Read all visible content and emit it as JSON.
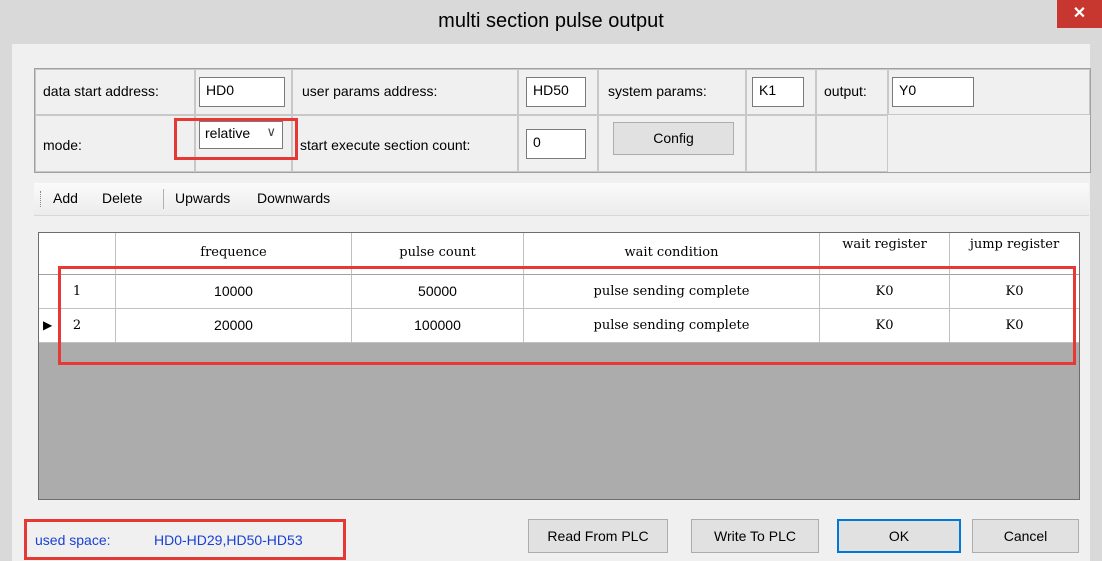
{
  "window": {
    "title": "multi section pulse output",
    "close_glyph": "✕"
  },
  "params": {
    "data_start_label": "data start address:",
    "data_start_value": "HD0",
    "user_params_label": "user params address:",
    "user_params_value": "HD50",
    "system_params_label": "system params:",
    "system_params_value": "K1",
    "output_label": "output:",
    "output_value": "Y0",
    "mode_label": "mode:",
    "mode_value": "relative",
    "start_exec_label": "start execute section count:",
    "start_exec_value": "0",
    "config_button": "Config"
  },
  "toolbar": {
    "add": "Add",
    "delete": "Delete",
    "upwards": "Upwards",
    "downwards": "Downwards"
  },
  "table": {
    "columns": [
      "frequence",
      "pulse count",
      "wait condition",
      "wait register",
      "jump register"
    ],
    "rows": [
      {
        "index": "1",
        "frequence": "10000",
        "pulse_count": "50000",
        "wait_condition": "pulse sending complete",
        "wait_register": "K0",
        "jump_register": "K0"
      },
      {
        "index": "2",
        "frequence": "20000",
        "pulse_count": "100000",
        "wait_condition": "pulse sending complete",
        "wait_register": "K0",
        "jump_register": "K0"
      }
    ],
    "current_row_marker": "▶"
  },
  "footer": {
    "used_space_label": "used space:",
    "used_space_value": "HD0-HD29,HD50-HD53",
    "read_button": "Read From PLC",
    "write_button": "Write To PLC",
    "ok_button": "OK",
    "cancel_button": "Cancel"
  },
  "colors": {
    "highlight": "#e53935",
    "used_space_text": "#1a3fd6",
    "close_button": "#c7362f",
    "ok_border": "#0078d7"
  }
}
